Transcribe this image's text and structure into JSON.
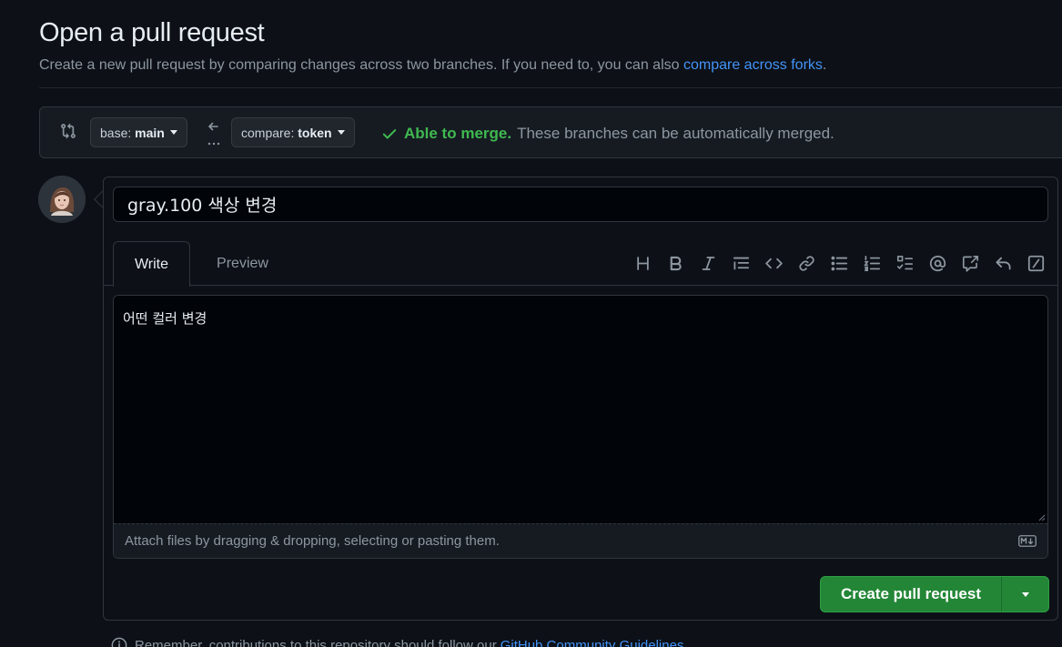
{
  "header": {
    "title": "Open a pull request",
    "subtitle": "Create a new pull request by comparing changes across two branches. If you need to, you can also",
    "subtitle_link": "compare across forks",
    "subtitle_end": "."
  },
  "range": {
    "base_prefix": "base:",
    "base_branch": "main",
    "compare_prefix": "compare:",
    "compare_branch": "token",
    "merge_status": "Able to merge.",
    "merge_description": "These branches can be automatically merged."
  },
  "form": {
    "title_value": "gray.100 색상 변경",
    "tabs": {
      "write": "Write",
      "preview": "Preview"
    },
    "body_value": "어떤 컬러 변경",
    "attach_hint": "Attach files by dragging & dropping, selecting or pasting them.",
    "submit_label": "Create pull request"
  },
  "toolbar_icons": [
    "heading-icon",
    "bold-icon",
    "italic-icon",
    "quote-icon",
    "code-icon",
    "link-icon",
    "unordered-list-icon",
    "ordered-list-icon",
    "task-list-icon",
    "mention-icon",
    "cross-reference-icon",
    "saved-replies-icon",
    "slash-commands-icon"
  ],
  "footer": {
    "note": "Remember, contributions to this repository should follow our",
    "link": "GitHub Community Guidelines"
  },
  "colors": {
    "background": "#0d1117",
    "accent_link": "#4493f8",
    "success": "#3fb950",
    "primary_button": "#238636"
  }
}
